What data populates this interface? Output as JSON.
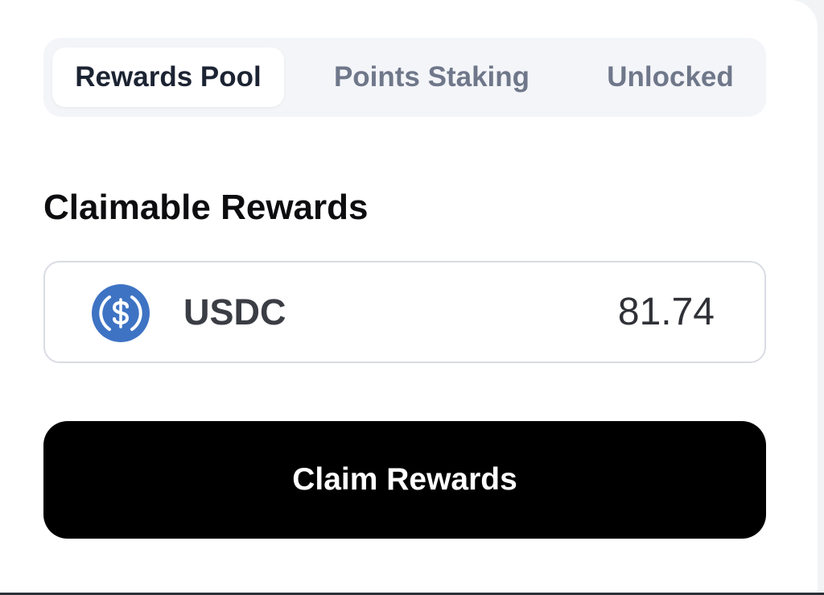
{
  "tabs": [
    {
      "label": "Rewards Pool",
      "active": true
    },
    {
      "label": "Points Staking",
      "active": false
    },
    {
      "label": "Unlocked",
      "active": false
    }
  ],
  "section": {
    "title": "Claimable Rewards"
  },
  "reward": {
    "icon": "usdc-icon",
    "token": "USDC",
    "amount": "81.74",
    "icon_color": "#3e73c4"
  },
  "actions": {
    "claim_label": "Claim Rewards"
  },
  "colors": {
    "primary_button": "#000000",
    "tabbar_background": "#f4f5f9",
    "active_tab_text": "#1c2433",
    "inactive_tab_text": "#6f778a"
  }
}
